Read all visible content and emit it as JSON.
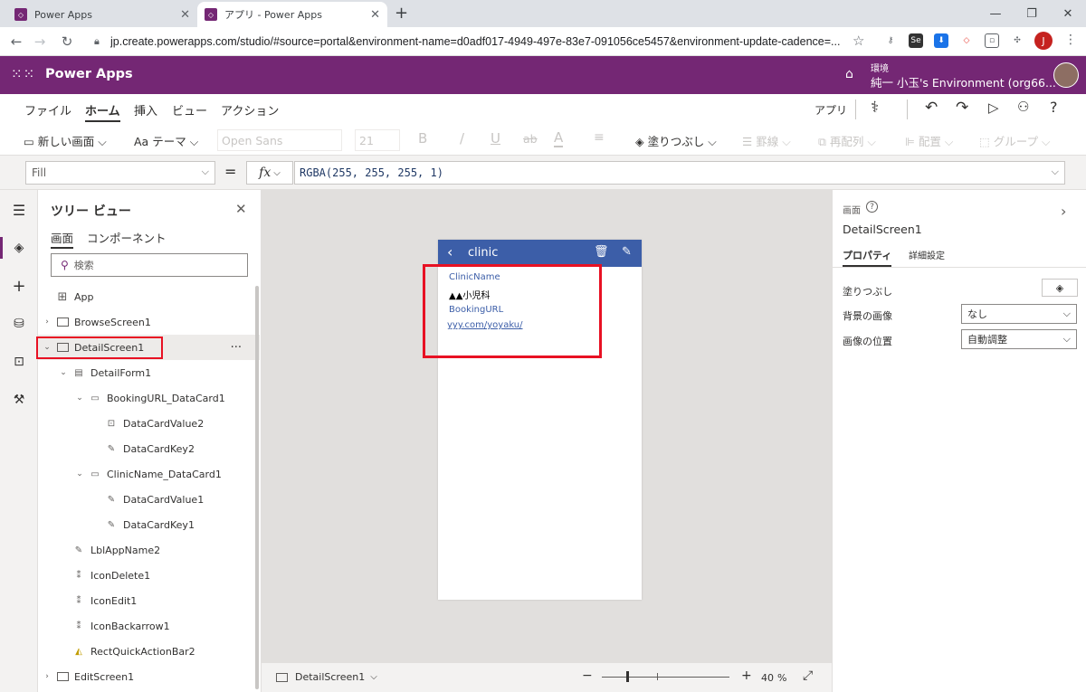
{
  "browser": {
    "tabs": [
      {
        "title": "Power Apps"
      },
      {
        "title": "アプリ - Power Apps"
      }
    ],
    "url": "jp.create.powerapps.com/studio/#source=portal&environment-name=d0adf017-4949-497e-83e7-091056ce5457&environment-update-cadence=...",
    "profile_initial": "J"
  },
  "app_header": {
    "brand": "Power Apps",
    "env_label": "環境",
    "env_name": "純一 小玉's Environment (org66..."
  },
  "ribbon": {
    "tabs": [
      "ファイル",
      "ホーム",
      "挿入",
      "ビュー",
      "アクション"
    ],
    "active_tab": "ホーム",
    "right_label": "アプリ",
    "tools": {
      "new_screen": "新しい画面",
      "theme": "テーマ",
      "font": "Open Sans",
      "size": "21",
      "bold": "B",
      "italic": "/",
      "underline": "U",
      "strike": "ab",
      "fill": "塗りつぶし",
      "border": "罫線",
      "reorder": "再配列",
      "align": "配置",
      "group": "グループ"
    }
  },
  "formula_bar": {
    "property": "Fill",
    "equals": "=",
    "fx": "fx",
    "formula": "RGBA(255, 255, 255, 1)"
  },
  "tree_view": {
    "title": "ツリー ビュー",
    "tabs": [
      "画面",
      "コンポーネント"
    ],
    "search_placeholder": "検索",
    "items": [
      {
        "label": "App"
      },
      {
        "label": "BrowseScreen1"
      },
      {
        "label": "DetailScreen1"
      },
      {
        "label": "DetailForm1"
      },
      {
        "label": "BookingURL_DataCard1"
      },
      {
        "label": "DataCardValue2"
      },
      {
        "label": "DataCardKey2"
      },
      {
        "label": "ClinicName_DataCard1"
      },
      {
        "label": "DataCardValue1"
      },
      {
        "label": "DataCardKey1"
      },
      {
        "label": "LblAppName2"
      },
      {
        "label": "IconDelete1"
      },
      {
        "label": "IconEdit1"
      },
      {
        "label": "IconBackarrow1"
      },
      {
        "label": "RectQuickActionBar2"
      },
      {
        "label": "EditScreen1"
      }
    ],
    "more": "···"
  },
  "app_screen": {
    "title": "clinic",
    "field1_label": "ClinicName",
    "field1_value": "▲▲小児科",
    "field2_label": "BookingURL",
    "field2_value": "yyy.com/yoyaku/",
    "header_color": "#3c5ea8"
  },
  "status": {
    "screen": "DetailScreen1",
    "zoom": "40",
    "zoom_unit": "%"
  },
  "properties": {
    "section": "画面",
    "screen_name": "DetailScreen1",
    "tabs": [
      "プロパティ",
      "詳細設定"
    ],
    "fill_label": "塗りつぶし",
    "bg_image_label": "背景の画像",
    "bg_image_value": "なし",
    "image_pos_label": "画像の位置",
    "image_pos_value": "自動調整"
  },
  "colors": {
    "brand": "#742774",
    "highlight": "#e81123",
    "link": "#3c5ea8"
  }
}
